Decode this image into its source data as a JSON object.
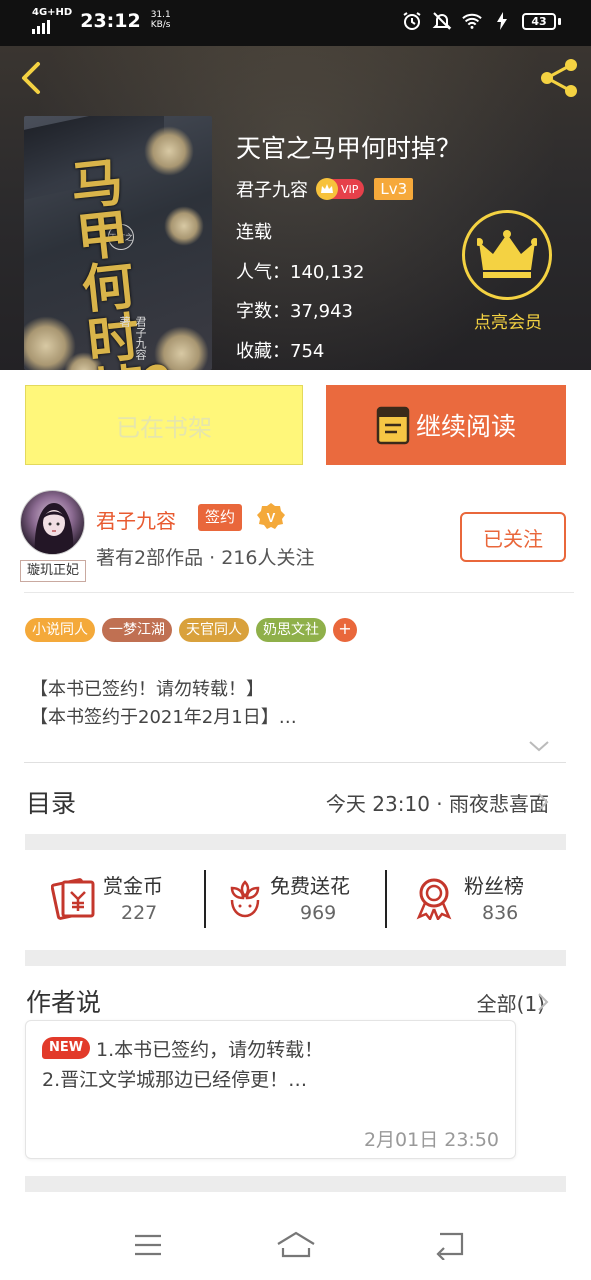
{
  "status_bar": {
    "network": "4G+HD",
    "time": "23:12",
    "speed_value": "31.1",
    "speed_unit": "KB/s",
    "battery": "43",
    "icons": [
      "alarm-icon",
      "mute-icon",
      "wifi-icon",
      "charging-icon"
    ]
  },
  "book": {
    "title": "天官之马甲何时掉？",
    "author": "君子九容",
    "vip_badge": "VIP",
    "level": "Lv3",
    "status": "连载",
    "popularity_label": "人气：",
    "popularity_value": "140,132",
    "words_label": "字数：",
    "words_value": "37,943",
    "favorites_label": "收藏：",
    "favorites_value": "754",
    "cover": {
      "title_chars": "马甲何时掉？",
      "subtitle": "天官之",
      "author": "君子九容 著"
    }
  },
  "vip": {
    "label": "点亮会员"
  },
  "actions": {
    "shelf_label": "已在书架",
    "read_label": "继续阅读"
  },
  "author": {
    "name": "君子九容",
    "sign_badge": "签约",
    "v_badge": "V",
    "avatar_tag": "璇玑正妃",
    "info": "著有2部作品 · 216人关注",
    "follow_label": "已关注"
  },
  "tags": [
    {
      "label": "小说同人",
      "color": "#f4a93a"
    },
    {
      "label": "一梦江湖",
      "color": "#c07052"
    },
    {
      "label": "天官同人",
      "color": "#d9a13c"
    },
    {
      "label": "奶思文社",
      "color": "#8fb04a"
    }
  ],
  "tags_more": "+",
  "notice": {
    "line1": "【本书已签约！请勿转载！】",
    "line2": "【本书签约于2021年2月1日】…"
  },
  "toc": {
    "title": "目录",
    "latest": "今天 23:10 · 雨夜悲喜面"
  },
  "rewards": [
    {
      "label": "赏金币",
      "value": "227",
      "icon": "gold-coin-envelope-icon"
    },
    {
      "label": "免费送花",
      "value": "969",
      "icon": "flower-icon"
    },
    {
      "label": "粉丝榜",
      "value": "836",
      "icon": "medal-icon"
    }
  ],
  "author_says": {
    "title": "作者说",
    "all_label": "全部(1)",
    "new_badge": "NEW",
    "line1": "1.本书已签约，请勿转载！",
    "line2": "2.晋江文学城那边已经停更！…",
    "time": "2月01日  23:50"
  },
  "colors": {
    "accent": "#ea6a3e",
    "shelf": "#fff77a",
    "vip_gold": "#f4d242",
    "hero_bg": "#2b2a2c"
  },
  "nav": {
    "icons": [
      "menu-icon",
      "home-icon",
      "back-icon"
    ]
  }
}
